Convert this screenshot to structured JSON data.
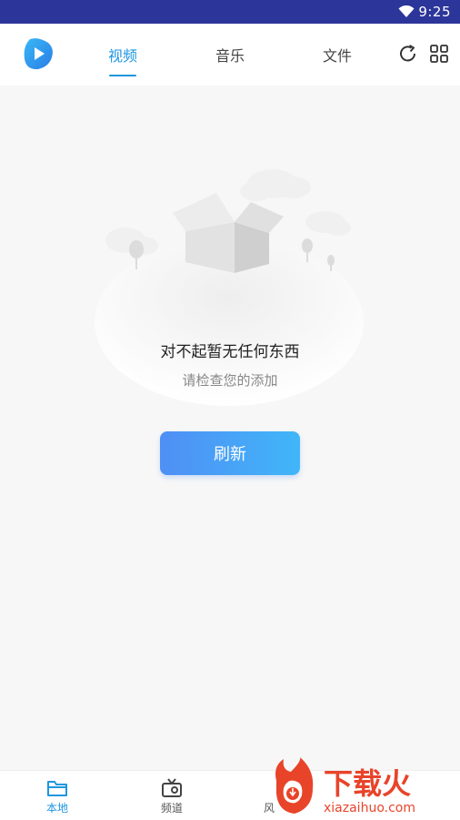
{
  "status_bar": {
    "time": "9:25"
  },
  "header": {
    "tabs": [
      {
        "label": "视频",
        "active": true
      },
      {
        "label": "音乐",
        "active": false
      },
      {
        "label": "文件",
        "active": false
      }
    ],
    "icons": [
      "refresh-icon",
      "grid-icon"
    ]
  },
  "empty_state": {
    "title": "对不起暂无任何东西",
    "subtitle": "请检查您的添加",
    "button_label": "刷新"
  },
  "bottom_nav": {
    "items": [
      {
        "label": "本地",
        "icon": "folder-icon",
        "active": true
      },
      {
        "label": "频道",
        "icon": "tv-icon",
        "active": false
      },
      {
        "label": "风",
        "icon": "",
        "active": false
      },
      {
        "label": "",
        "icon": "",
        "active": false
      }
    ]
  },
  "watermark": {
    "brand": "下载火",
    "url": "xiazaihuo.com"
  },
  "colors": {
    "accent": "#1f96e0",
    "status_bar": "#2c3599",
    "button_start": "#4f8ff5",
    "button_end": "#41b6f8"
  }
}
